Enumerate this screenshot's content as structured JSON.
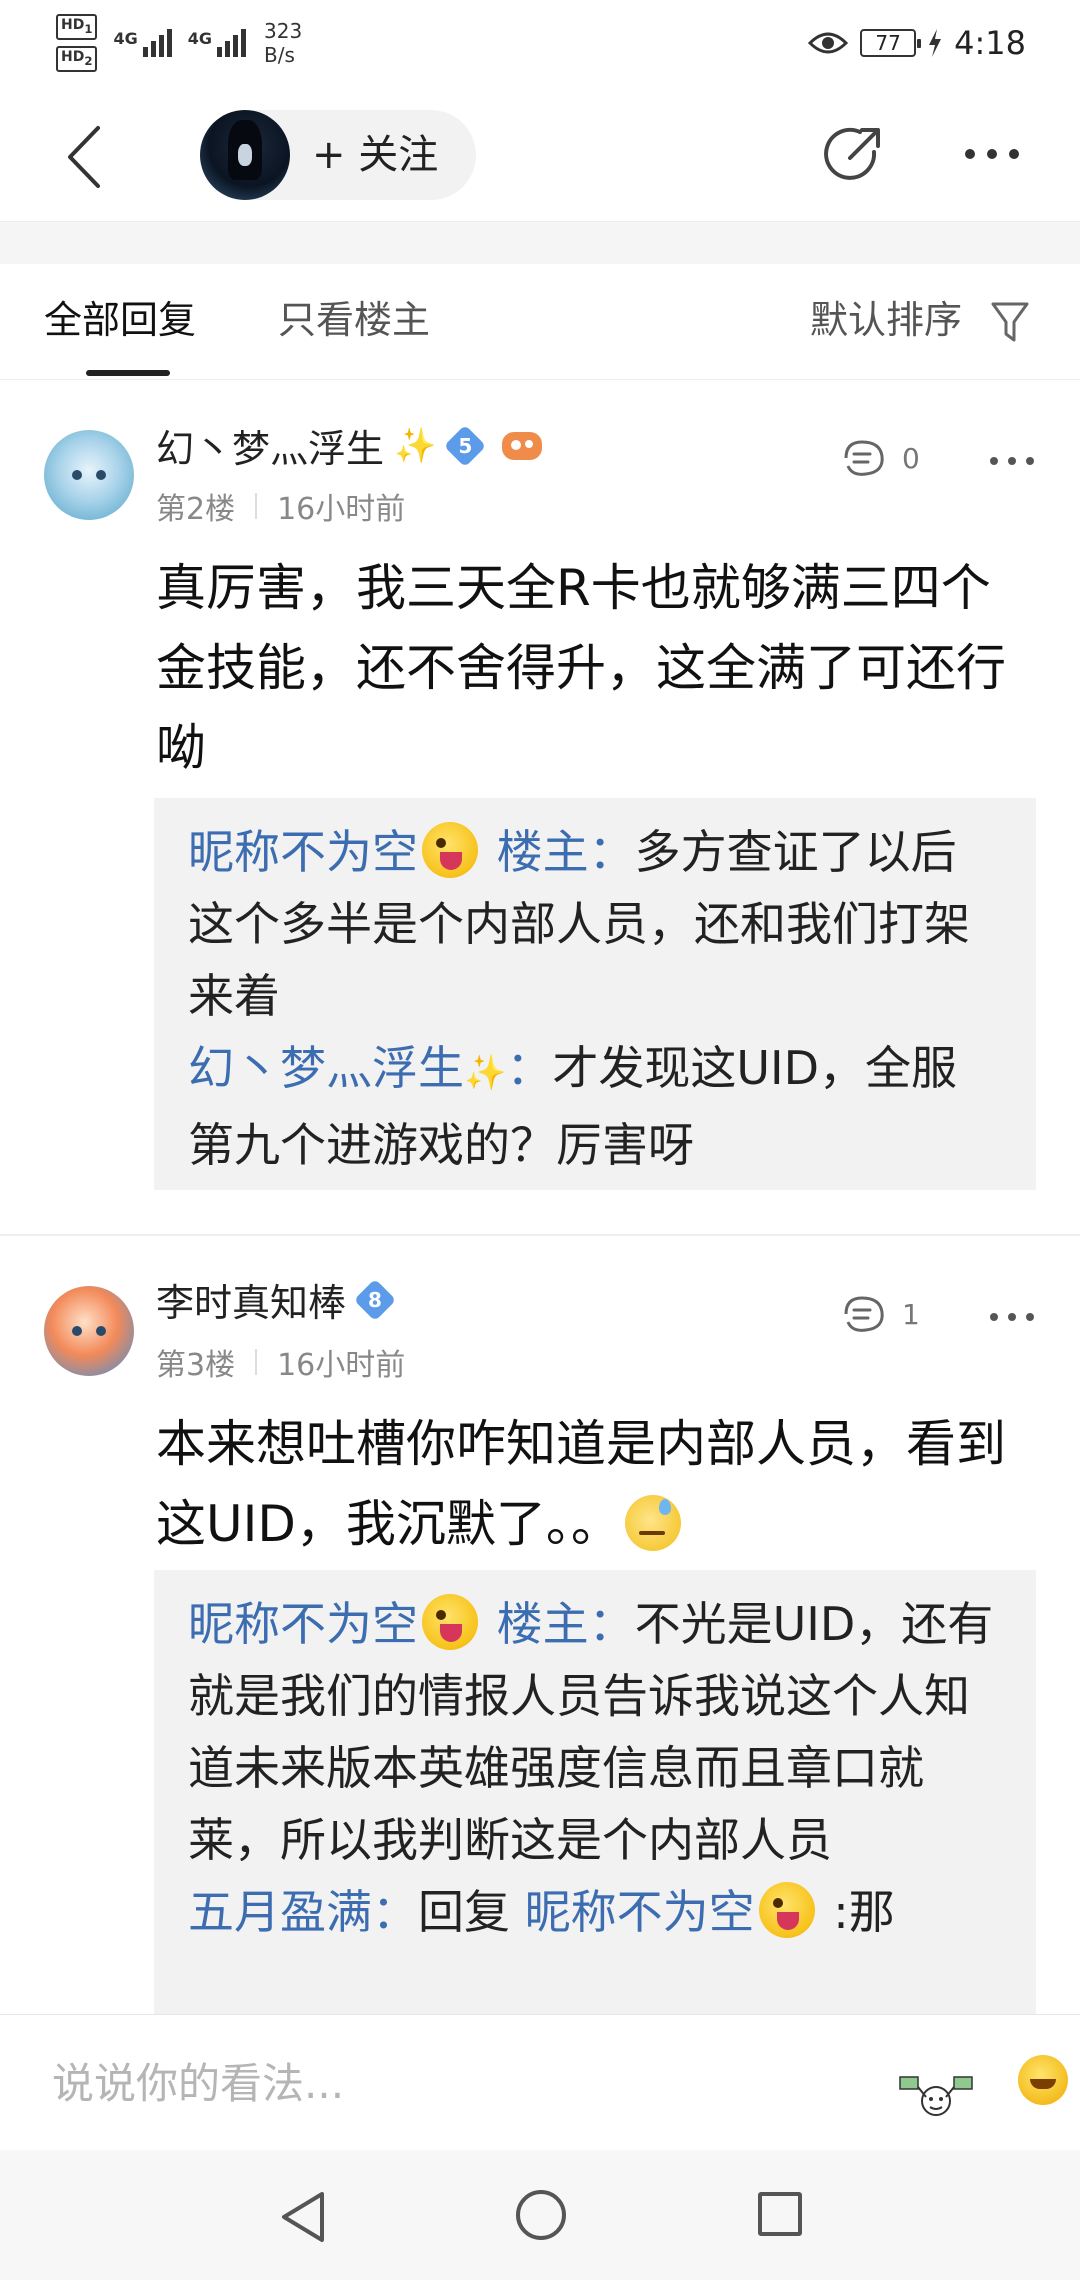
{
  "status_bar": {
    "hd1": "HD",
    "hd1_sub": "1",
    "hd2": "HD",
    "hd2_sub": "2",
    "sig1": "4G",
    "sig2": "4G",
    "net_speed": "323",
    "net_unit": "B/s",
    "battery": "77",
    "time": "4:18"
  },
  "top_nav": {
    "follow_label": "+ 关注"
  },
  "tabs": {
    "all_replies": "全部回复",
    "op_only": "只看楼主",
    "sort": "默认排序"
  },
  "posts": [
    {
      "username": "幻丶梦灬浮生",
      "sparkle": "✨",
      "level": "5",
      "floor": "第2楼",
      "time": "16小时前",
      "likes": "0",
      "content": "真厉害，我三天全R卡也就够满三四个金技能，还不舍得升，这全满了可还行呦",
      "replies": [
        {
          "name": "昵称不为空",
          "tag": "楼主",
          "colon": "：",
          "text": "多方查证了以后这个多半是个内部人员，还和我们打架来着"
        },
        {
          "name": "幻丶梦灬浮生",
          "sparkle": "✨",
          "colon": "：",
          "text": "才发现这UID，全服第九个进游戏的？厉害呀"
        }
      ]
    },
    {
      "username": "李时真知棒",
      "level": "8",
      "floor": "第3楼",
      "time": "16小时前",
      "likes": "1",
      "content": "本来想吐槽你咋知道是内部人员，看到这UID，我沉默了。。",
      "replies": [
        {
          "name": "昵称不为空",
          "tag": "楼主",
          "colon": "：",
          "text": "不光是UID，还有就是我们的情报人员告诉我说这个人知道未来版本英雄强度信息而且章口就莱，所以我判断这是个内部人员"
        },
        {
          "name": "五月盈满",
          "colon": "：",
          "reply_word": "回复",
          "reply_to": "昵称不为空",
          "text": ":那"
        }
      ]
    }
  ],
  "comment_bar": {
    "placeholder": "说说你的看法..."
  },
  "icons": {
    "back": "back-arrow-icon",
    "share": "share-icon",
    "more": "more-dots-icon",
    "filter": "filter-funnel-icon",
    "like": "like-hand-icon",
    "emoji": "emoji-icon"
  },
  "colors": {
    "accent_name": "#3d6db1",
    "level_badge": "#5b9bea",
    "reply_bg": "#f2f2f2"
  }
}
